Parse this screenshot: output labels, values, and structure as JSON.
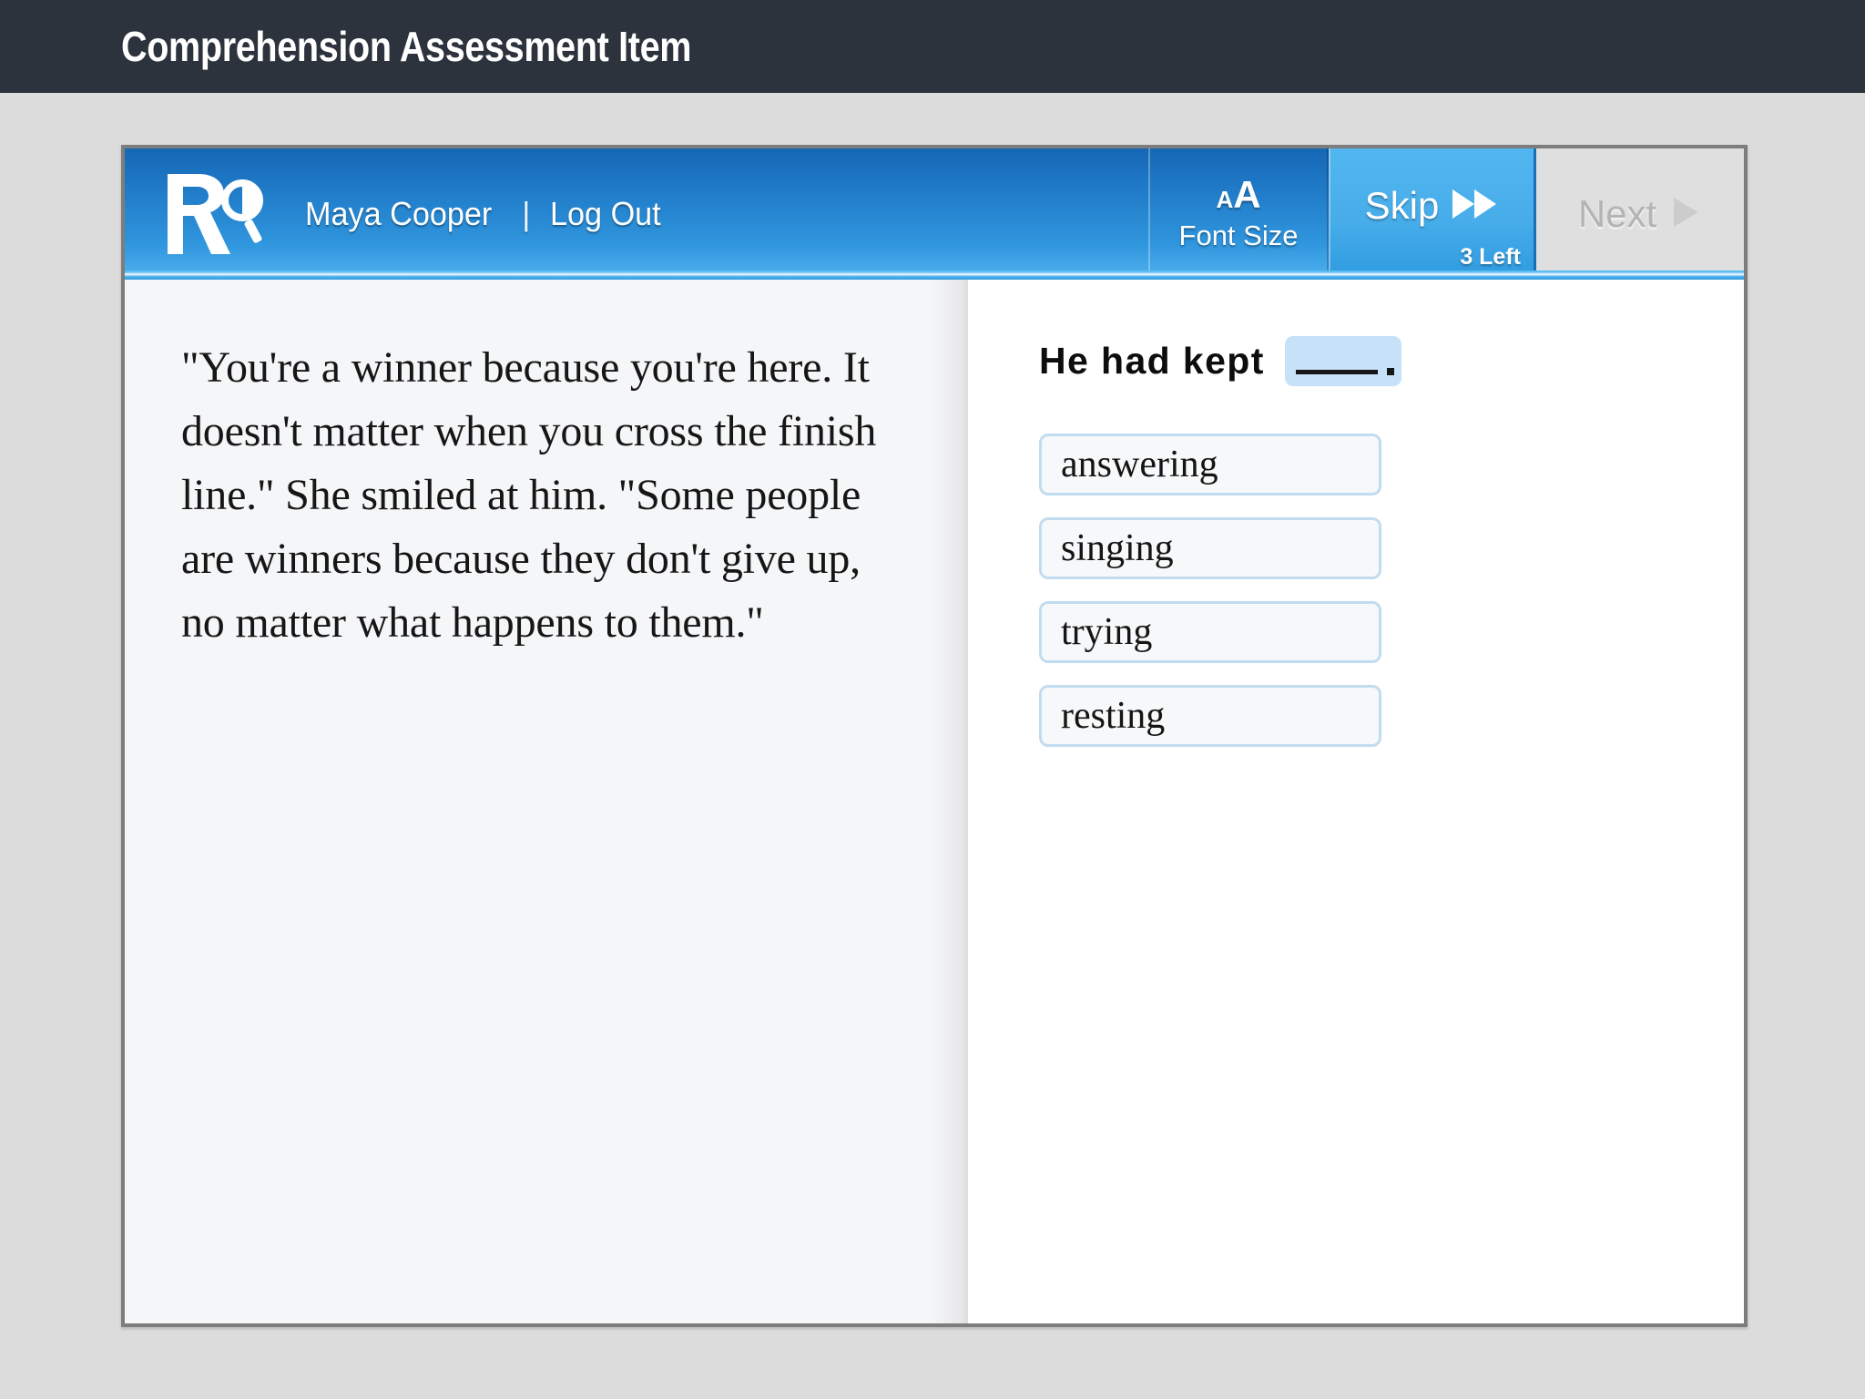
{
  "header": {
    "title": "Comprehension Assessment Item"
  },
  "toolbar": {
    "logo_icon": "r-magnifier-logo-icon",
    "user_name": "Maya Cooper",
    "separator": "|",
    "logout_label": "Log Out",
    "font_size": {
      "small_a": "A",
      "large_a": "A",
      "label": "Font Size",
      "icon": "font-size-icon"
    },
    "skip": {
      "label": "Skip",
      "icon": "double-right-arrow-icon",
      "count_label": "3 Left"
    },
    "next": {
      "label": "Next",
      "icon": "right-arrow-icon",
      "disabled": true
    },
    "accent_color": "#2f95dd",
    "skip_color": "#47adea",
    "next_disabled_color": "#dfdfdf"
  },
  "passage": {
    "text": "\"You're a winner because you're here. It doesn't matter when you cross the finish line.\" She smiled at him. \"Some people are winners because they don't give up, no matter what happens to them.\""
  },
  "question": {
    "prompt_prefix": "He had kept",
    "blank_placeholder": "",
    "blank_color": "#c6e1f8",
    "punctuation": ".",
    "choices": [
      {
        "label": "answering"
      },
      {
        "label": "singing"
      },
      {
        "label": "trying"
      },
      {
        "label": "resting"
      }
    ]
  }
}
